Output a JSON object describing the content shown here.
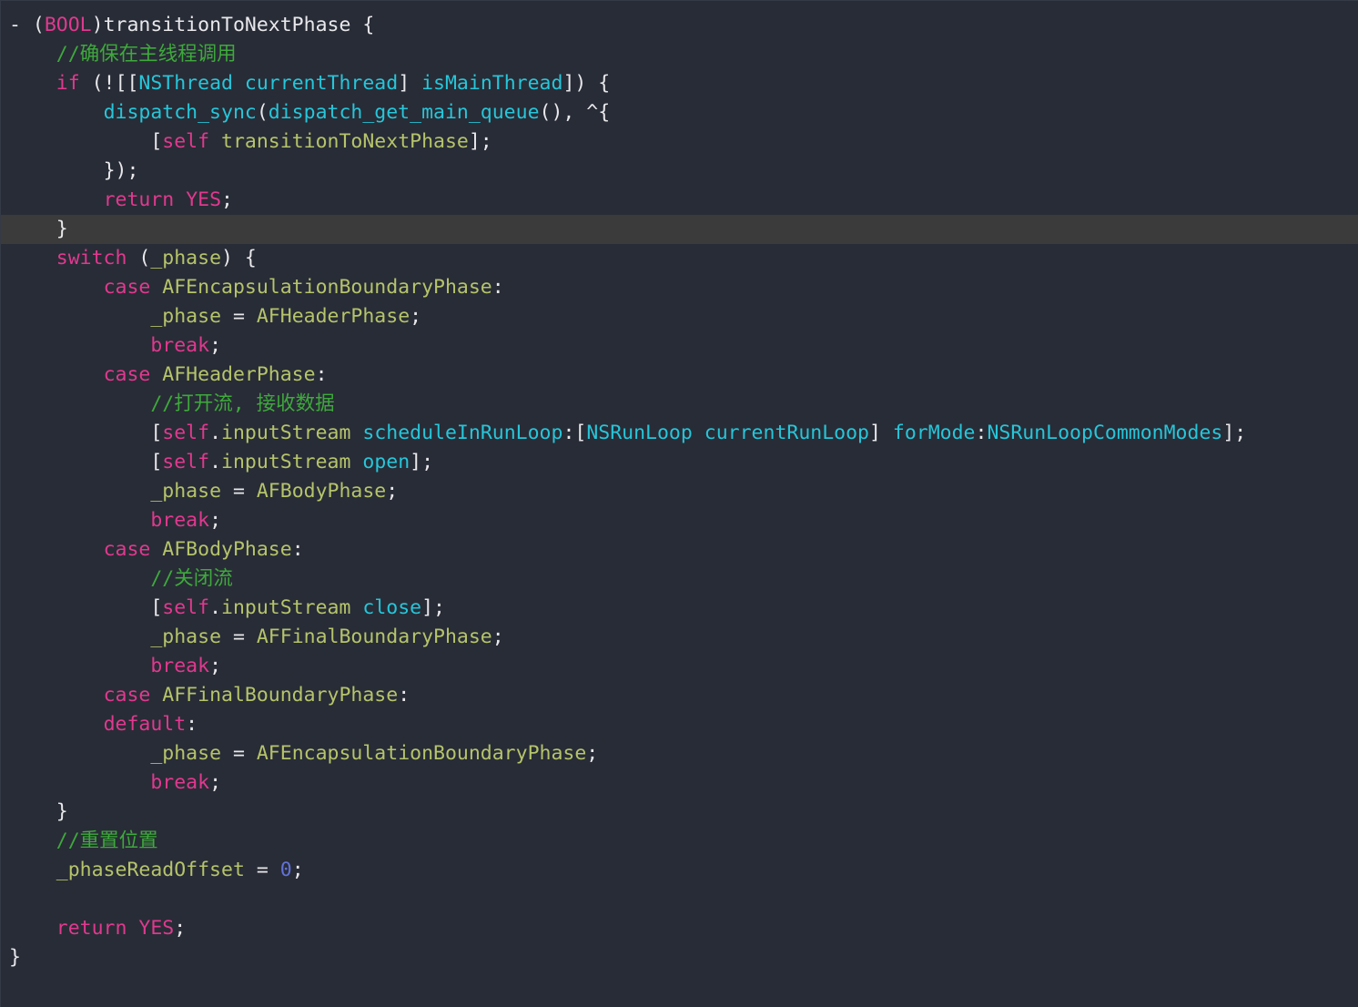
{
  "editor": {
    "language": "Objective-C",
    "background_color": "#282c36",
    "current_line_background": "#3b3b3b",
    "current_line_index": 7,
    "theme_colors": {
      "plain": "#e8e8ec",
      "keyword": "#e0398f",
      "class": "#26c6da",
      "identifier": "#b5c46b",
      "comment": "#3ea93c",
      "number": "#6272d8"
    }
  },
  "code": {
    "lines": [
      {
        "indent": 0,
        "tokens": [
          {
            "t": "- ",
            "c": "pl"
          },
          {
            "t": "(",
            "c": "pl"
          },
          {
            "t": "BOOL",
            "c": "kw"
          },
          {
            "t": ")transitionToNextPhase {",
            "c": "pl"
          }
        ]
      },
      {
        "indent": 1,
        "tokens": [
          {
            "t": "//确保在主线程调用",
            "c": "cmt"
          }
        ]
      },
      {
        "indent": 1,
        "tokens": [
          {
            "t": "if",
            "c": "kw"
          },
          {
            "t": " (![[",
            "c": "pl"
          },
          {
            "t": "NSThread",
            "c": "cls"
          },
          {
            "t": " ",
            "c": "pl"
          },
          {
            "t": "currentThread",
            "c": "cls"
          },
          {
            "t": "] ",
            "c": "pl"
          },
          {
            "t": "isMainThread",
            "c": "cls"
          },
          {
            "t": "]) {",
            "c": "pl"
          }
        ]
      },
      {
        "indent": 2,
        "tokens": [
          {
            "t": "dispatch_sync",
            "c": "cls"
          },
          {
            "t": "(",
            "c": "pl"
          },
          {
            "t": "dispatch_get_main_queue",
            "c": "cls"
          },
          {
            "t": "(), ^{",
            "c": "pl"
          }
        ]
      },
      {
        "indent": 3,
        "tokens": [
          {
            "t": "[",
            "c": "pl"
          },
          {
            "t": "self",
            "c": "kw"
          },
          {
            "t": " ",
            "c": "pl"
          },
          {
            "t": "transitionToNextPhase",
            "c": "ident"
          },
          {
            "t": "];",
            "c": "pl"
          }
        ]
      },
      {
        "indent": 2,
        "tokens": [
          {
            "t": "});",
            "c": "pl"
          }
        ]
      },
      {
        "indent": 2,
        "tokens": [
          {
            "t": "return",
            "c": "kw"
          },
          {
            "t": " ",
            "c": "pl"
          },
          {
            "t": "YES",
            "c": "kw"
          },
          {
            "t": ";",
            "c": "pl"
          }
        ]
      },
      {
        "indent": 1,
        "highlight": true,
        "tokens": [
          {
            "t": "}",
            "c": "pl"
          }
        ]
      },
      {
        "indent": 1,
        "tokens": [
          {
            "t": "switch",
            "c": "kw"
          },
          {
            "t": " (",
            "c": "pl"
          },
          {
            "t": "_phase",
            "c": "ident"
          },
          {
            "t": ") {",
            "c": "pl"
          }
        ]
      },
      {
        "indent": 2,
        "tokens": [
          {
            "t": "case",
            "c": "kw"
          },
          {
            "t": " ",
            "c": "pl"
          },
          {
            "t": "AFEncapsulationBoundaryPhase",
            "c": "ident"
          },
          {
            "t": ":",
            "c": "pl"
          }
        ]
      },
      {
        "indent": 3,
        "tokens": [
          {
            "t": "_phase",
            "c": "ident"
          },
          {
            "t": " = ",
            "c": "pl"
          },
          {
            "t": "AFHeaderPhase",
            "c": "ident"
          },
          {
            "t": ";",
            "c": "pl"
          }
        ]
      },
      {
        "indent": 3,
        "tokens": [
          {
            "t": "break",
            "c": "kw"
          },
          {
            "t": ";",
            "c": "pl"
          }
        ]
      },
      {
        "indent": 2,
        "tokens": [
          {
            "t": "case",
            "c": "kw"
          },
          {
            "t": " ",
            "c": "pl"
          },
          {
            "t": "AFHeaderPhase",
            "c": "ident"
          },
          {
            "t": ":",
            "c": "pl"
          }
        ]
      },
      {
        "indent": 3,
        "tokens": [
          {
            "t": "//打开流, 接收数据",
            "c": "cmt"
          }
        ]
      },
      {
        "indent": 3,
        "tokens": [
          {
            "t": "[",
            "c": "pl"
          },
          {
            "t": "self",
            "c": "kw"
          },
          {
            "t": ".",
            "c": "pl"
          },
          {
            "t": "inputStream",
            "c": "ident"
          },
          {
            "t": " ",
            "c": "pl"
          },
          {
            "t": "scheduleInRunLoop",
            "c": "sel"
          },
          {
            "t": ":[",
            "c": "pl"
          },
          {
            "t": "NSRunLoop",
            "c": "cls"
          },
          {
            "t": " ",
            "c": "pl"
          },
          {
            "t": "currentRunLoop",
            "c": "cls"
          },
          {
            "t": "] ",
            "c": "pl"
          },
          {
            "t": "forMode",
            "c": "sel"
          },
          {
            "t": ":",
            "c": "pl"
          },
          {
            "t": "NSRunLoopCommonModes",
            "c": "cls"
          },
          {
            "t": "];",
            "c": "pl"
          }
        ]
      },
      {
        "indent": 3,
        "tokens": [
          {
            "t": "[",
            "c": "pl"
          },
          {
            "t": "self",
            "c": "kw"
          },
          {
            "t": ".",
            "c": "pl"
          },
          {
            "t": "inputStream",
            "c": "ident"
          },
          {
            "t": " ",
            "c": "pl"
          },
          {
            "t": "open",
            "c": "sel"
          },
          {
            "t": "];",
            "c": "pl"
          }
        ]
      },
      {
        "indent": 3,
        "tokens": [
          {
            "t": "_phase",
            "c": "ident"
          },
          {
            "t": " = ",
            "c": "pl"
          },
          {
            "t": "AFBodyPhase",
            "c": "ident"
          },
          {
            "t": ";",
            "c": "pl"
          }
        ]
      },
      {
        "indent": 3,
        "tokens": [
          {
            "t": "break",
            "c": "kw"
          },
          {
            "t": ";",
            "c": "pl"
          }
        ]
      },
      {
        "indent": 2,
        "tokens": [
          {
            "t": "case",
            "c": "kw"
          },
          {
            "t": " ",
            "c": "pl"
          },
          {
            "t": "AFBodyPhase",
            "c": "ident"
          },
          {
            "t": ":",
            "c": "pl"
          }
        ]
      },
      {
        "indent": 3,
        "tokens": [
          {
            "t": "//关闭流",
            "c": "cmt"
          }
        ]
      },
      {
        "indent": 3,
        "tokens": [
          {
            "t": "[",
            "c": "pl"
          },
          {
            "t": "self",
            "c": "kw"
          },
          {
            "t": ".",
            "c": "pl"
          },
          {
            "t": "inputStream",
            "c": "ident"
          },
          {
            "t": " ",
            "c": "pl"
          },
          {
            "t": "close",
            "c": "sel"
          },
          {
            "t": "];",
            "c": "pl"
          }
        ]
      },
      {
        "indent": 3,
        "tokens": [
          {
            "t": "_phase",
            "c": "ident"
          },
          {
            "t": " = ",
            "c": "pl"
          },
          {
            "t": "AFFinalBoundaryPhase",
            "c": "ident"
          },
          {
            "t": ";",
            "c": "pl"
          }
        ]
      },
      {
        "indent": 3,
        "tokens": [
          {
            "t": "break",
            "c": "kw"
          },
          {
            "t": ";",
            "c": "pl"
          }
        ]
      },
      {
        "indent": 2,
        "tokens": [
          {
            "t": "case",
            "c": "kw"
          },
          {
            "t": " ",
            "c": "pl"
          },
          {
            "t": "AFFinalBoundaryPhase",
            "c": "ident"
          },
          {
            "t": ":",
            "c": "pl"
          }
        ]
      },
      {
        "indent": 2,
        "tokens": [
          {
            "t": "default",
            "c": "kw"
          },
          {
            "t": ":",
            "c": "pl"
          }
        ]
      },
      {
        "indent": 3,
        "tokens": [
          {
            "t": "_phase",
            "c": "ident"
          },
          {
            "t": " = ",
            "c": "pl"
          },
          {
            "t": "AFEncapsulationBoundaryPhase",
            "c": "ident"
          },
          {
            "t": ";",
            "c": "pl"
          }
        ]
      },
      {
        "indent": 3,
        "tokens": [
          {
            "t": "break",
            "c": "kw"
          },
          {
            "t": ";",
            "c": "pl"
          }
        ]
      },
      {
        "indent": 1,
        "tokens": [
          {
            "t": "}",
            "c": "pl"
          }
        ]
      },
      {
        "indent": 1,
        "tokens": [
          {
            "t": "//重置位置",
            "c": "cmt"
          }
        ]
      },
      {
        "indent": 1,
        "tokens": [
          {
            "t": "_phaseReadOffset",
            "c": "ident"
          },
          {
            "t": " = ",
            "c": "pl"
          },
          {
            "t": "0",
            "c": "num"
          },
          {
            "t": ";",
            "c": "pl"
          }
        ]
      },
      {
        "indent": 0,
        "tokens": []
      },
      {
        "indent": 1,
        "tokens": [
          {
            "t": "return",
            "c": "kw"
          },
          {
            "t": " ",
            "c": "pl"
          },
          {
            "t": "YES",
            "c": "kw"
          },
          {
            "t": ";",
            "c": "pl"
          }
        ]
      },
      {
        "indent": 0,
        "tokens": [
          {
            "t": "}",
            "c": "pl"
          }
        ]
      }
    ]
  }
}
